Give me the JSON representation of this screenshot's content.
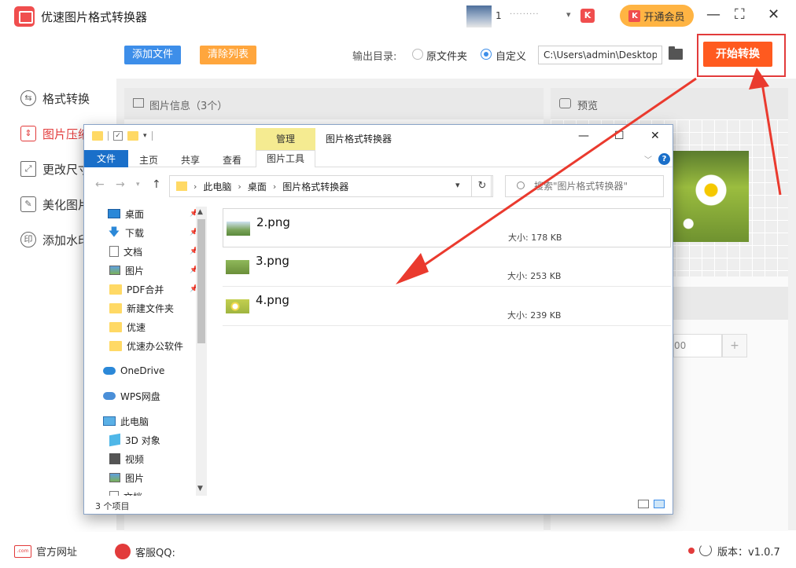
{
  "app": {
    "title": "优速图片格式转换器",
    "user_name": "1",
    "user_masked": "·········",
    "vip_label": "开通会员",
    "vip_badge": "K",
    "window_controls": [
      "—",
      "⛶",
      "✕"
    ]
  },
  "sidebar": {
    "items": [
      {
        "label": "格式转换",
        "icon": "format-convert-icon",
        "active": false
      },
      {
        "label": "图片压缩",
        "icon": "compress-icon",
        "active": true
      },
      {
        "label": "更改尺寸",
        "icon": "resize-icon",
        "active": false
      },
      {
        "label": "美化图片",
        "icon": "beautify-icon",
        "active": false
      },
      {
        "label": "添加水印",
        "icon": "watermark-icon",
        "active": false
      }
    ]
  },
  "toolbar": {
    "add_label": "添加文件",
    "clear_label": "清除列表",
    "output_label": "输出目录:",
    "radio_original": "原文件夹",
    "radio_custom": "自定义",
    "selected_output": "custom",
    "output_path": "C:\\Users\\admin\\Desktop",
    "start_label": "开始转换"
  },
  "info_panel": {
    "title": "图片信息（3个）"
  },
  "preview_panel": {
    "title": "预览"
  },
  "settings": {
    "quantity_value": "00",
    "plus_label": "+"
  },
  "footer": {
    "website_label": "官方网址",
    "website_icon_text": ".com",
    "service_label": "客服QQ:",
    "version_label": "版本：v1.0.7"
  },
  "explorer": {
    "title": "图片格式转换器",
    "manage_tab": "管理",
    "ribbon_tabs": [
      "文件",
      "主页",
      "共享",
      "查看"
    ],
    "picture_tools_tab": "图片工具",
    "window_controls": [
      "—",
      "☐",
      "✕"
    ],
    "breadcrumb": [
      "此电脑",
      "桌面",
      "图片格式转换器"
    ],
    "search_placeholder": "搜索\"图片格式转换器\"",
    "nav_items": [
      {
        "label": "桌面",
        "icon": "desktop-icon",
        "pinned": true
      },
      {
        "label": "下载",
        "icon": "download-icon",
        "pinned": true
      },
      {
        "label": "文档",
        "icon": "document-icon",
        "pinned": true
      },
      {
        "label": "图片",
        "icon": "pictures-icon",
        "pinned": true
      },
      {
        "label": "PDF合并",
        "icon": "folder-icon",
        "pinned": true
      },
      {
        "label": "新建文件夹",
        "icon": "folder-icon",
        "pinned": false
      },
      {
        "label": "优速",
        "icon": "folder-icon",
        "pinned": false
      },
      {
        "label": "优速办公软件",
        "icon": "folder-icon",
        "pinned": false
      },
      {
        "label": "OneDrive",
        "icon": "onedrive-icon",
        "pinned": false
      },
      {
        "label": "WPS网盘",
        "icon": "wps-cloud-icon",
        "pinned": false
      },
      {
        "label": "此电脑",
        "icon": "this-pc-icon",
        "pinned": false
      },
      {
        "label": "3D 对象",
        "icon": "3d-objects-icon",
        "pinned": false
      },
      {
        "label": "视频",
        "icon": "videos-icon",
        "pinned": false
      },
      {
        "label": "图片",
        "icon": "pictures-icon",
        "pinned": false
      },
      {
        "label": "文档",
        "icon": "document-icon",
        "pinned": false
      }
    ],
    "files": [
      {
        "name": "2.png",
        "size": "大小: 178 KB",
        "thumb": "#7aa35a"
      },
      {
        "name": "3.png",
        "size": "大小: 253 KB",
        "thumb": "#6b8f3a"
      },
      {
        "name": "4.png",
        "size": "大小: 239 KB",
        "thumb": "#9fb540"
      }
    ],
    "status": "3 个项目"
  },
  "colors": {
    "accent_blue": "#3d8ee9",
    "accent_orange": "#ffa63d",
    "start_button": "#ff5a1f",
    "highlight_red": "#e23b3b",
    "vip_gold": "#ffb443",
    "explorer_blue": "#1a6fc9"
  }
}
